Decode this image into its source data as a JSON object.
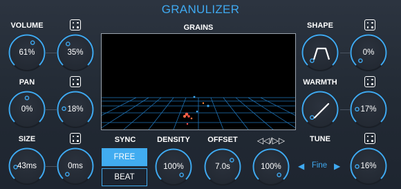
{
  "app": {
    "title": "GRANULIZER"
  },
  "colors": {
    "accent": "#3fa9f0",
    "background": "#252d38",
    "grain_dots": "#ff6a4a"
  },
  "grains": {
    "label": "GRAINS"
  },
  "volume": {
    "label": "VOLUME",
    "value": "61%",
    "spread": "35%",
    "level": 0.61,
    "spread_level": 0.35
  },
  "pan": {
    "label": "PAN",
    "value": "0%",
    "spread": "18%",
    "level": 0.5,
    "spread_level": 0.18
  },
  "size": {
    "label": "SIZE",
    "value": "43ms",
    "spread": "0ms",
    "level": 0.15,
    "spread_level": 0.0
  },
  "sync": {
    "label": "SYNC",
    "options": [
      "FREE",
      "BEAT"
    ],
    "selected": "FREE"
  },
  "density": {
    "label": "DENSITY",
    "value": "100%",
    "level": 1.0
  },
  "offset": {
    "label": "OFFSET",
    "value": "7.0s",
    "level": 0.7
  },
  "direction": {
    "label": "◁◁/▷▷",
    "value": "100%",
    "level": 1.0
  },
  "shape": {
    "label": "SHAPE",
    "spread": "0%",
    "spread_level": 0.0,
    "icon": "trapezoid-envelope-icon"
  },
  "warmth": {
    "label": "WARMTH",
    "spread": "17%",
    "spread_level": 0.17,
    "icon": "diagonal-line-icon"
  },
  "tune": {
    "label": "TUNE",
    "mode": "Fine",
    "spread": "16%",
    "spread_level": 0.16
  },
  "icons": {
    "dice": "dice-icon",
    "left": "left-triangle-icon",
    "right": "right-triangle-icon"
  }
}
